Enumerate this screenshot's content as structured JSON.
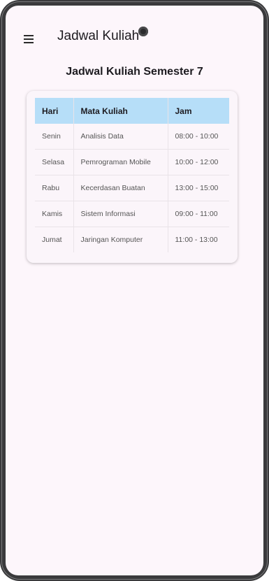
{
  "appbar": {
    "title": "Jadwal Kuliah",
    "menu_icon": "hamburger-menu-icon"
  },
  "page": {
    "heading": "Jadwal Kuliah Semester 7"
  },
  "table": {
    "headers": [
      "Hari",
      "Mata Kuliah",
      "Jam"
    ],
    "header_color": "#b6def8",
    "rows": [
      {
        "hari": "Senin",
        "mata_kuliah": "Analisis Data",
        "jam": "08:00 - 10:00"
      },
      {
        "hari": "Selasa",
        "mata_kuliah": "Pemrograman Mobile",
        "jam": "10:00 - 12:00"
      },
      {
        "hari": "Rabu",
        "mata_kuliah": "Kecerdasan Buatan",
        "jam": "13:00 - 15:00"
      },
      {
        "hari": "Kamis",
        "mata_kuliah": "Sistem Informasi",
        "jam": "09:00 - 11:00"
      },
      {
        "hari": "Jumat",
        "mata_kuliah": "Jaringan Komputer",
        "jam": "11:00 - 13:00"
      }
    ]
  },
  "colors": {
    "background": "#fdf6fb",
    "frame": "#3a3a3c"
  }
}
